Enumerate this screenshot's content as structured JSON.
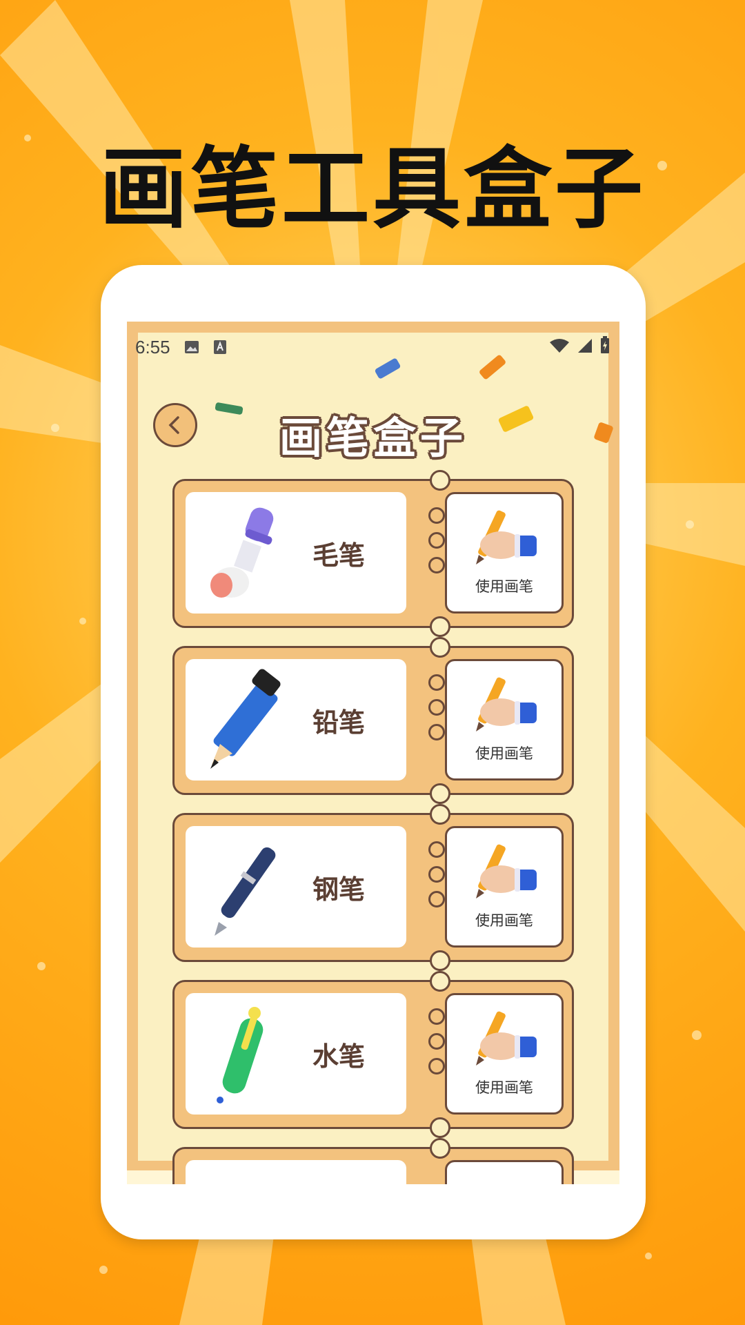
{
  "headline": "画笔工具盒子",
  "status_bar": {
    "time": "6:55"
  },
  "header": {
    "title": "画笔盒子"
  },
  "pens": [
    {
      "name": "毛笔",
      "icon": "brush-icon",
      "action": "使用画笔"
    },
    {
      "name": "铅笔",
      "icon": "pencil-icon",
      "action": "使用画笔"
    },
    {
      "name": "钢笔",
      "icon": "fountain-pen-icon",
      "action": "使用画笔"
    },
    {
      "name": "水笔",
      "icon": "marker-pen-icon",
      "action": "使用画笔"
    },
    {
      "name": "",
      "icon": "pen-icon",
      "action": ""
    }
  ],
  "colors": {
    "background": "#ffb21f",
    "screen_bg": "#fbf0c2",
    "ticket": "#f3c27e",
    "outline": "#6b4a3a",
    "text": "#5b3f33"
  }
}
